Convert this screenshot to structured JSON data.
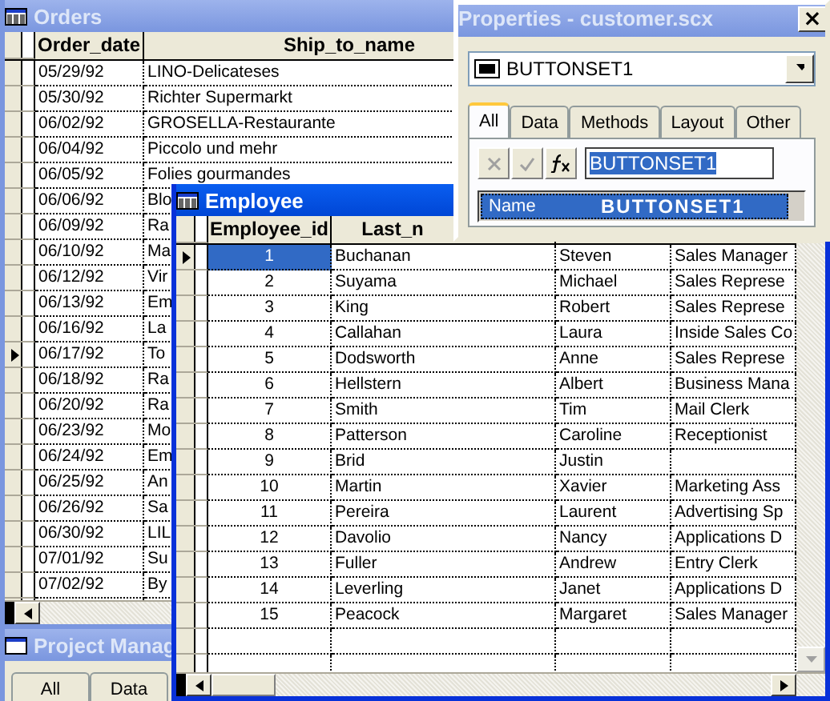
{
  "orders_window": {
    "title": "Orders",
    "active": false,
    "columns": [
      "Order_date",
      "Ship_to_name"
    ],
    "rows": [
      {
        "cells": [
          "05/29/92",
          "LINO-Delicateses"
        ],
        "current": false
      },
      {
        "cells": [
          "05/30/92",
          "Richter Supermarkt"
        ],
        "current": false
      },
      {
        "cells": [
          "06/02/92",
          "GROSELLA-Restaurante"
        ],
        "current": false
      },
      {
        "cells": [
          "06/04/92",
          "Piccolo und mehr"
        ],
        "current": false
      },
      {
        "cells": [
          "06/05/92",
          "Folies gourmandes"
        ],
        "current": false
      },
      {
        "cells": [
          "06/06/92",
          "Blo"
        ],
        "current": false
      },
      {
        "cells": [
          "06/09/92",
          "Ra"
        ],
        "current": false
      },
      {
        "cells": [
          "06/10/92",
          "Ma"
        ],
        "current": false
      },
      {
        "cells": [
          "06/12/92",
          "Vir"
        ],
        "current": false
      },
      {
        "cells": [
          "06/13/92",
          "Em"
        ],
        "current": false
      },
      {
        "cells": [
          "06/16/92",
          "La"
        ],
        "current": false
      },
      {
        "cells": [
          "06/17/92",
          "To"
        ],
        "current": true
      },
      {
        "cells": [
          "06/18/92",
          "Ra"
        ],
        "current": false
      },
      {
        "cells": [
          "06/20/92",
          "Ra"
        ],
        "current": false
      },
      {
        "cells": [
          "06/23/92",
          "Mo"
        ],
        "current": false
      },
      {
        "cells": [
          "06/24/92",
          "Em"
        ],
        "current": false
      },
      {
        "cells": [
          "06/25/92",
          "An"
        ],
        "current": false
      },
      {
        "cells": [
          "06/26/92",
          "Sa"
        ],
        "current": false
      },
      {
        "cells": [
          "06/30/92",
          "LIL"
        ],
        "current": false
      },
      {
        "cells": [
          "07/01/92",
          "Su"
        ],
        "current": false
      },
      {
        "cells": [
          "07/02/92",
          "By"
        ],
        "current": false
      }
    ]
  },
  "project_manager": {
    "title": "Project Manag",
    "active": false,
    "tabs": [
      "All",
      "Data"
    ]
  },
  "employee_window": {
    "title": "Employee",
    "active": true,
    "columns": [
      "Employee_id",
      "Last_n"
    ],
    "rows": [
      {
        "cells": [
          "1",
          "Buchanan",
          "Steven",
          "Sales Manager"
        ],
        "current": true,
        "selected": true
      },
      {
        "cells": [
          "2",
          "Suyama",
          "Michael",
          "Sales Represe"
        ],
        "current": false,
        "selected": false
      },
      {
        "cells": [
          "3",
          "King",
          "Robert",
          "Sales Represe"
        ],
        "current": false,
        "selected": false
      },
      {
        "cells": [
          "4",
          "Callahan",
          "Laura",
          "Inside Sales Co"
        ],
        "current": false,
        "selected": false
      },
      {
        "cells": [
          "5",
          "Dodsworth",
          "Anne",
          "Sales Represe"
        ],
        "current": false,
        "selected": false
      },
      {
        "cells": [
          "6",
          "Hellstern",
          "Albert",
          "Business Mana"
        ],
        "current": false,
        "selected": false
      },
      {
        "cells": [
          "7",
          "Smith",
          "Tim",
          "Mail Clerk"
        ],
        "current": false,
        "selected": false
      },
      {
        "cells": [
          "8",
          "Patterson",
          "Caroline",
          "Receptionist"
        ],
        "current": false,
        "selected": false
      },
      {
        "cells": [
          "9",
          "Brid",
          "Justin"
        ],
        "current": false,
        "selected": false
      },
      {
        "cells": [
          "10",
          "Martin",
          "Xavier",
          "Marketing Ass"
        ],
        "current": false,
        "selected": false
      },
      {
        "cells": [
          "11",
          "Pereira",
          "Laurent",
          "Advertising Sp"
        ],
        "current": false,
        "selected": false
      },
      {
        "cells": [
          "12",
          "Davolio",
          "Nancy",
          "Applications D"
        ],
        "current": false,
        "selected": false
      },
      {
        "cells": [
          "13",
          "Fuller",
          "Andrew",
          "Entry Clerk"
        ],
        "current": false,
        "selected": false
      },
      {
        "cells": [
          "14",
          "Leverling",
          "Janet",
          "Applications D"
        ],
        "current": false,
        "selected": false
      },
      {
        "cells": [
          "15",
          "Peacock",
          "Margaret",
          "Sales Manager"
        ],
        "current": false,
        "selected": false
      }
    ]
  },
  "properties_window": {
    "title": "Properties - customer.scx",
    "active": false,
    "close": "×",
    "object": "BUTTONSET1",
    "tabs": [
      {
        "label": "All",
        "selected": true
      },
      {
        "label": "Data",
        "selected": false
      },
      {
        "label": "Methods",
        "selected": false
      },
      {
        "label": "Layout",
        "selected": false
      },
      {
        "label": "Other",
        "selected": false
      }
    ],
    "toolbar": {
      "cancel_disabled": true,
      "accept_disabled": true,
      "value": "BUTTONSET1"
    },
    "properties": [
      {
        "name": "Name",
        "value": "BUTTONSET1",
        "selected": true
      }
    ]
  }
}
